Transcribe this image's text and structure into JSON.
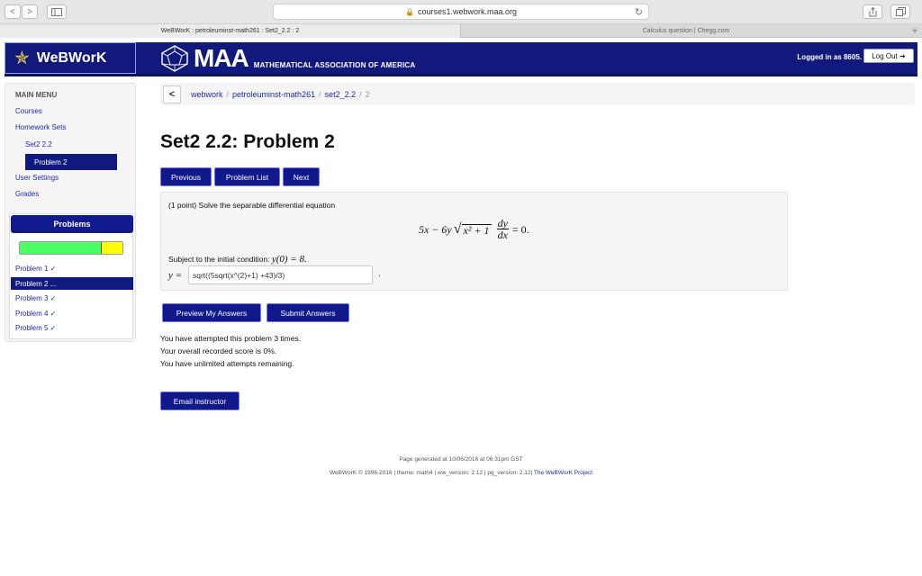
{
  "browser": {
    "url": "courses1.webwork.maa.org",
    "tab_active": "WeBWorK : petroleuminst-math261 : Set2_2.2 : 2",
    "tab_inactive": "Calculus question | Chegg.com",
    "back_glyph": "<",
    "forward_glyph": ">",
    "tab_plus_glyph": "+"
  },
  "header": {
    "app_name": "WeBWorK",
    "maa_title": "MAA",
    "maa_subtitle": "MATHEMATICAL ASSOCIATION OF AMERICA",
    "logged_in": "Logged in as 8605.",
    "logout_label": "Log Out ➔"
  },
  "sidebar": {
    "menu_title": "MAIN MENU",
    "items": {
      "courses": "Courses",
      "homework_sets": "Homework Sets",
      "set": "Set2 2.2",
      "problem": "Problem 2",
      "user_settings": "User Settings",
      "grades": "Grades"
    },
    "problems_title": "Problems",
    "progress": {
      "green_fraction": 0.8,
      "yellow_fraction": 0.2
    },
    "problem_list": [
      "Problem 1 ✓",
      "Problem 2 ...",
      "Problem 3 ✓",
      "Problem 4 ✓",
      "Problem 5 ✓"
    ]
  },
  "breadcrumb": {
    "back_glyph": "<",
    "parts": [
      "webwork",
      "petroleuminst-math261",
      "set2_2.2"
    ],
    "current": "2",
    "separator": "/"
  },
  "main": {
    "title": "Set2 2.2: Problem 2",
    "nav_buttons": [
      "Previous",
      "Problem List",
      "Next"
    ],
    "problem": {
      "intro": "(1 point) Solve the separable differential equation",
      "equation_lhs": "5x − 6y",
      "sqrt_content": "x² + 1",
      "frac_num": "dy",
      "frac_den": "dx",
      "equation_rhs": "= 0.",
      "condition_text": "Subject to the initial condition:",
      "condition_math": "y(0) = 8.",
      "answer_label": "y =",
      "answer_value": "sqrt((5sqrt(x^(2)+1) +43)/3)",
      "answer_tail": "."
    },
    "action_buttons": [
      "Preview My Answers",
      "Submit Answers"
    ],
    "status_lines": [
      "You have attempted this problem 3 times.",
      "Your overall recorded score is 0%.",
      "You have unlimited attempts remaining."
    ],
    "email_button": "Email instructor"
  },
  "footer": {
    "generated": "Page generated at 10/06/2016 at 06:31pm GST",
    "credits": "WeBWorK © 1996-2016 | theme: math4 | ww_version: 2.12 | pg_version: 2.12|",
    "project_link": "The WeBWorK Project"
  }
}
